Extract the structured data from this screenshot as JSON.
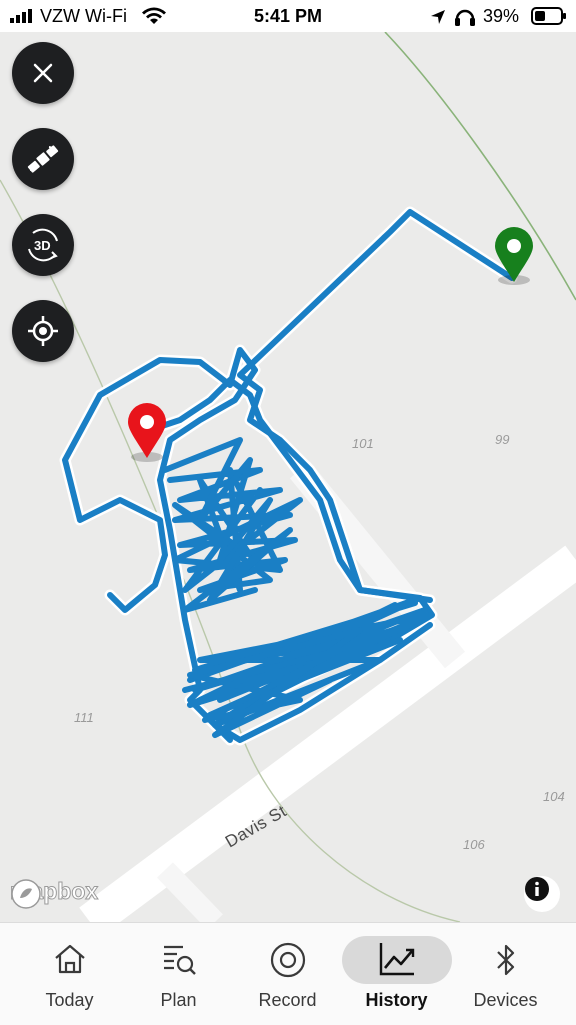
{
  "status_bar": {
    "carrier": "VZW Wi-Fi",
    "time": "5:41 PM",
    "battery": "39%"
  },
  "map": {
    "lot_numbers": [
      "101",
      "99",
      "111",
      "104",
      "106"
    ],
    "street_name": "Davis St",
    "attribution": "mapbox",
    "track_color": "#1a7fc5",
    "start_pin_color": "#e8141b",
    "end_pin_color": "#17801d"
  },
  "controls": {
    "icons": [
      "close-icon",
      "satellite-icon",
      "3d-icon",
      "locate-icon"
    ],
    "threed_label": "3D"
  },
  "tabs": [
    {
      "label": "Today",
      "icon": "home-icon"
    },
    {
      "label": "Plan",
      "icon": "plan-search-icon"
    },
    {
      "label": "Record",
      "icon": "record-icon"
    },
    {
      "label": "History",
      "icon": "history-chart-icon",
      "active": true
    },
    {
      "label": "Devices",
      "icon": "bluetooth-icon"
    }
  ]
}
